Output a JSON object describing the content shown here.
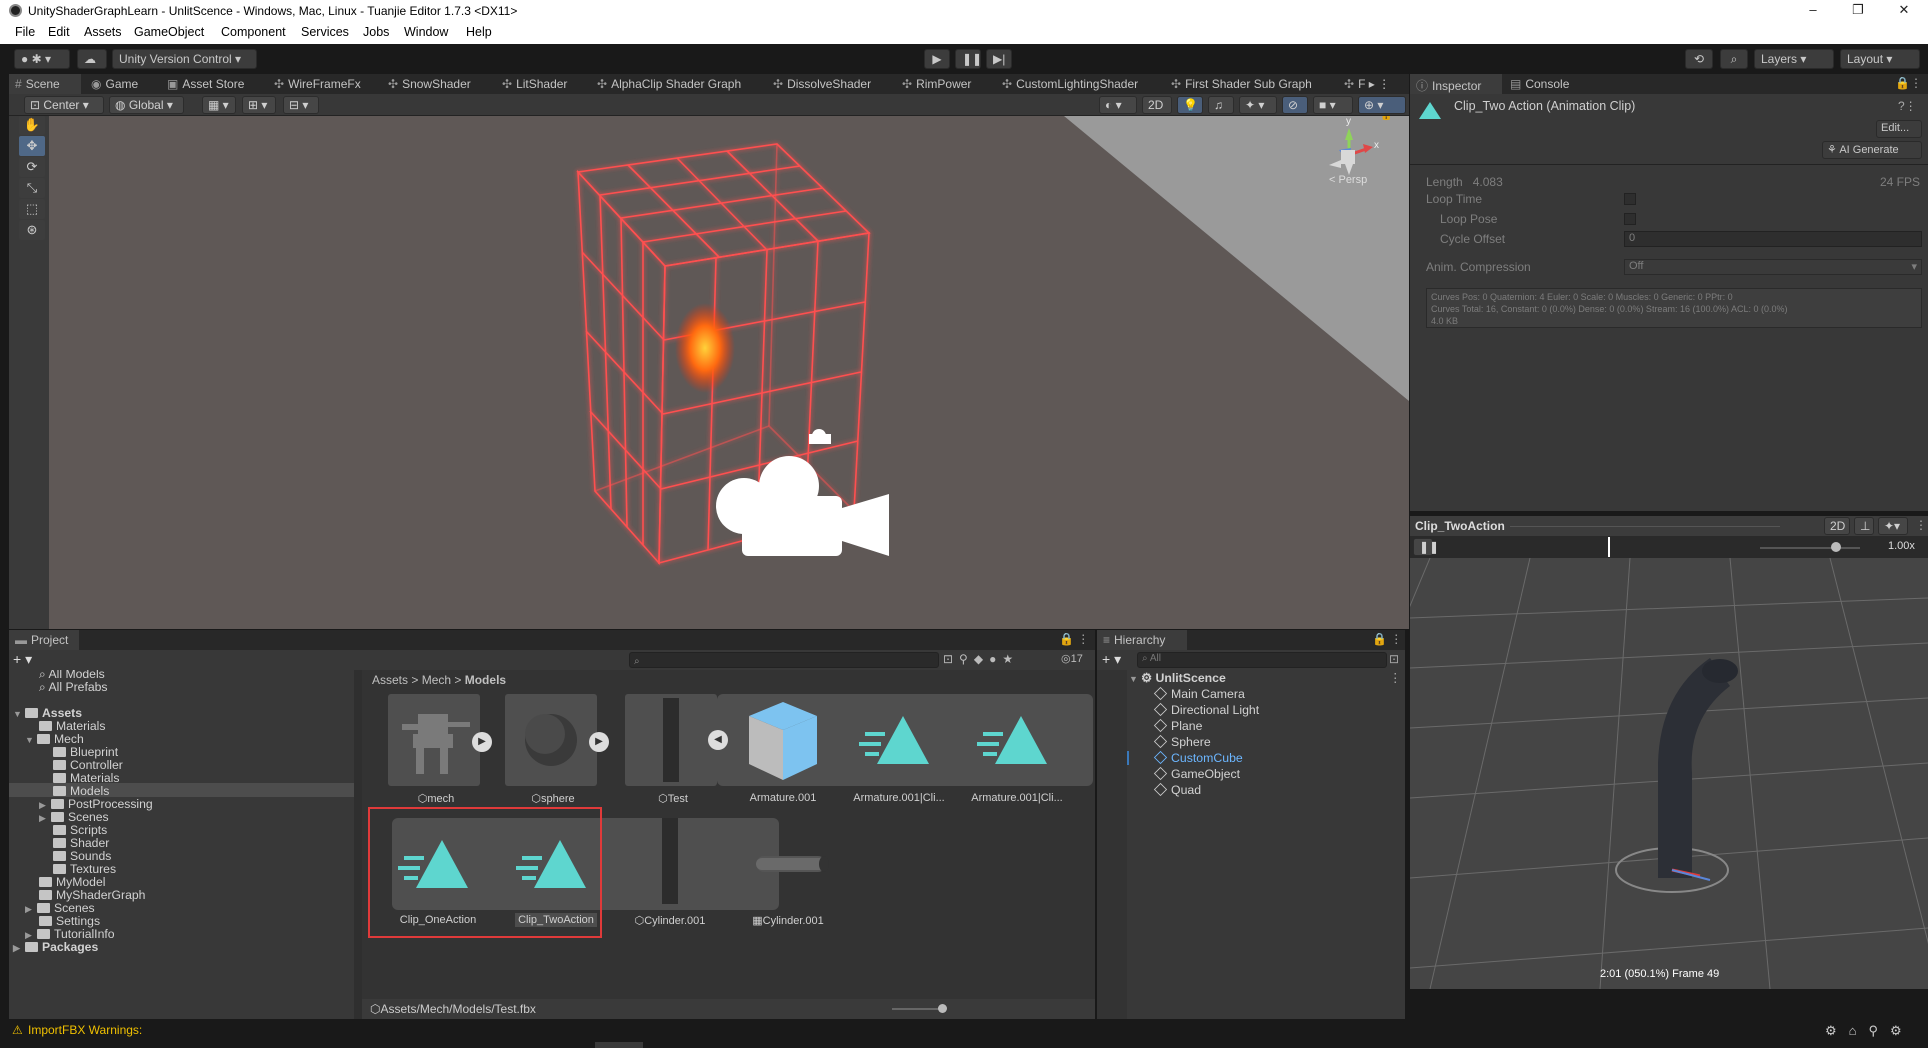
{
  "window": {
    "title": "UnityShaderGraphLearn - UnlitScence - Windows, Mac, Linux - Tuanjie Editor 1.7.3 <DX11>",
    "min": "–",
    "max": "❐",
    "close": "✕"
  },
  "menu": [
    "File",
    "Edit",
    "Assets",
    "GameObject",
    "Component",
    "Services",
    "Jobs",
    "Window",
    "Help"
  ],
  "toolbar": {
    "version_control": "Unity Version Control",
    "layers": "Layers",
    "layout": "Layout"
  },
  "scene_tabs": [
    "Scene",
    "Game",
    "Asset Store",
    "WireFrameFx",
    "SnowShader",
    "LitShader",
    "AlphaClip Shader Graph",
    "DissolveShader",
    "RimPower",
    "CustomLightingShader",
    "First Shader Sub Graph",
    "F"
  ],
  "scene_toolbar": {
    "pivot": "Center",
    "space": "Global",
    "mode_2d": "2D"
  },
  "gizmo": {
    "y": "y",
    "x": "x",
    "persp": "< Persp"
  },
  "inspector": {
    "tabs": [
      "Inspector",
      "Console"
    ],
    "title": "Clip_Two Action (Animation Clip)",
    "edit_button": "Edit...",
    "ai_button": "AI Generate",
    "length_label": "Length",
    "length_value": "4.083",
    "fps": "24 FPS",
    "loop_time": "Loop Time",
    "loop_pose": "Loop Pose",
    "cycle_offset": "Cycle Offset",
    "cycle_offset_value": "0",
    "anim_compression": "Anim. Compression",
    "anim_compression_value": "Off",
    "info_line1": "Curves Pos: 0 Quaternion: 4 Euler: 0 Scale: 0 Muscles: 0 Generic: 0 PPtr: 0",
    "info_line2": "Curves Total: 16, Constant: 0 (0.0%) Dense: 0 (0.0%) Stream: 16 (100.0%) ACL: 0 (0.0%)",
    "info_line3": "4.0 KB"
  },
  "preview": {
    "title": "Clip_TwoAction",
    "mode_2d": "2D",
    "speed": "1.00x",
    "frame": "2:01 (050.1%) Frame 49"
  },
  "project": {
    "tab": "Project",
    "tree": [
      {
        "label": "All Models"
      },
      {
        "label": "All Prefabs"
      },
      {
        "label": "Assets"
      },
      {
        "label": "Materials"
      },
      {
        "label": "Mech"
      },
      {
        "label": "Blueprint"
      },
      {
        "label": "Controller"
      },
      {
        "label": "Materials"
      },
      {
        "label": "Models"
      },
      {
        "label": "PostProcessing"
      },
      {
        "label": "Scenes"
      },
      {
        "label": "Scripts"
      },
      {
        "label": "Shader"
      },
      {
        "label": "Sounds"
      },
      {
        "label": "Textures"
      },
      {
        "label": "MyModel"
      },
      {
        "label": "MyShaderGraph"
      },
      {
        "label": "Scenes"
      },
      {
        "label": "Settings"
      },
      {
        "label": "TutorialInfo"
      },
      {
        "label": "Packages"
      }
    ],
    "breadcrumb": [
      "Assets",
      "Mech",
      "Models"
    ],
    "count": "17",
    "assets_row1": [
      "mech",
      "sphere",
      "Test",
      "Armature.001",
      "Armature.001|Cli...",
      "Armature.001|Cli..."
    ],
    "assets_row2": [
      "Clip_OneAction",
      "Clip_TwoAction",
      "Cylinder.001",
      "Cylinder.001"
    ],
    "path": "Assets/Mech/Models/Test.fbx"
  },
  "hierarchy": {
    "tab": "Hierarchy",
    "search_placeholder": "All",
    "scene": "UnlitScence",
    "items": [
      "Main Camera",
      "Directional Light",
      "Plane",
      "Sphere",
      "CustomCube",
      "GameObject",
      "Quad"
    ]
  },
  "status": {
    "warning": "ImportFBX Warnings:"
  },
  "colors": {
    "selected_blue": "#2c5d87",
    "highlight_red": "#e03a3a",
    "wire_red": "#ff4a4a",
    "clip_cyan": "#5ed6cf"
  }
}
